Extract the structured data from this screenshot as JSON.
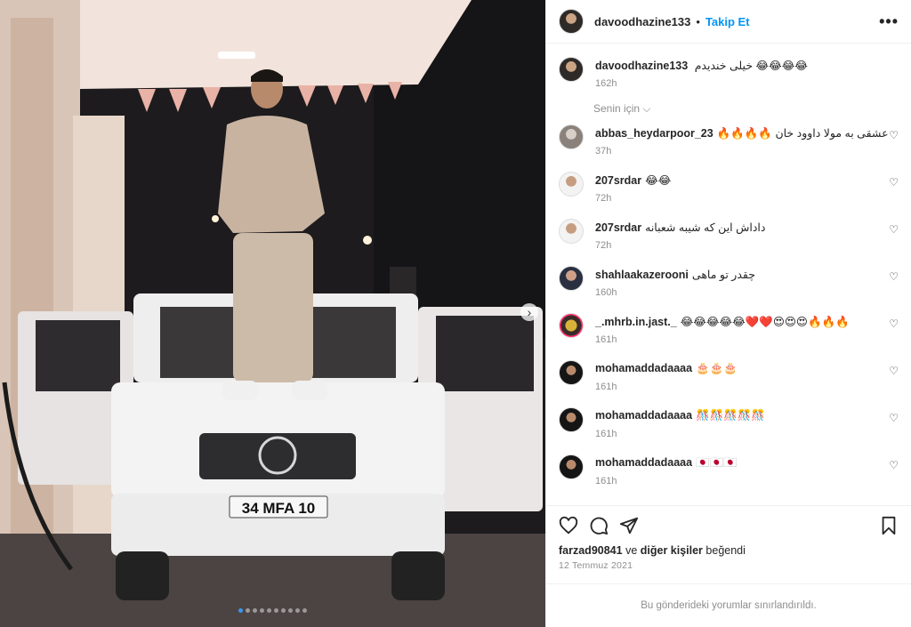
{
  "post": {
    "author": "davoodhazine133",
    "separator": "•",
    "follow_label": "Takip Et",
    "more_label": "•••",
    "caption": "خیلی خندیدم 😂😂😂😂",
    "caption_time": "162h",
    "for_you_label": "Senin için ⌵",
    "carousel_next": "›",
    "slide_count": 10,
    "active_slide": 0,
    "plate_text": "34 MFA 10"
  },
  "comments": [
    {
      "user": "abbas_heydarpoor_23",
      "text": "🔥🔥🔥🔥 عشقی به مولا داوود خان",
      "time": "37h"
    },
    {
      "user": "207srdar",
      "text": "😂😂",
      "time": "72h"
    },
    {
      "user": "207srdar",
      "text": "داداش این که شیبه شعبانه",
      "time": "72h"
    },
    {
      "user": "shahlaakazerooni",
      "text": "چقدر تو ماهی",
      "time": "160h"
    },
    {
      "user": "_.mhrb.in.jast._",
      "text": "😂😂😂😂😂❤️❤️😍😍😍🔥🔥🔥",
      "time": "161h"
    },
    {
      "user": "mohamaddadaaaa",
      "text": "🎂🎂🎂",
      "time": "161h"
    },
    {
      "user": "mohamaddadaaaa",
      "text": "🎊🎊🎊🎊🎊",
      "time": "161h"
    },
    {
      "user": "mohamaddadaaaa",
      "text": "🇯🇵🇯🇵🇯🇵",
      "time": "161h"
    }
  ],
  "heart_icon": "♡",
  "likes": {
    "user": "farzad90841",
    "connector": "ve",
    "others": "diğer kişiler",
    "suffix": "beğendi"
  },
  "date": "12 Temmuz 2021",
  "restricted_notice": "Bu gönderideki yorumlar sınırlandırıldı.",
  "icons": {
    "like": "heart-icon",
    "comment": "comment-icon",
    "share": "paper-plane-icon",
    "save": "bookmark-icon"
  }
}
